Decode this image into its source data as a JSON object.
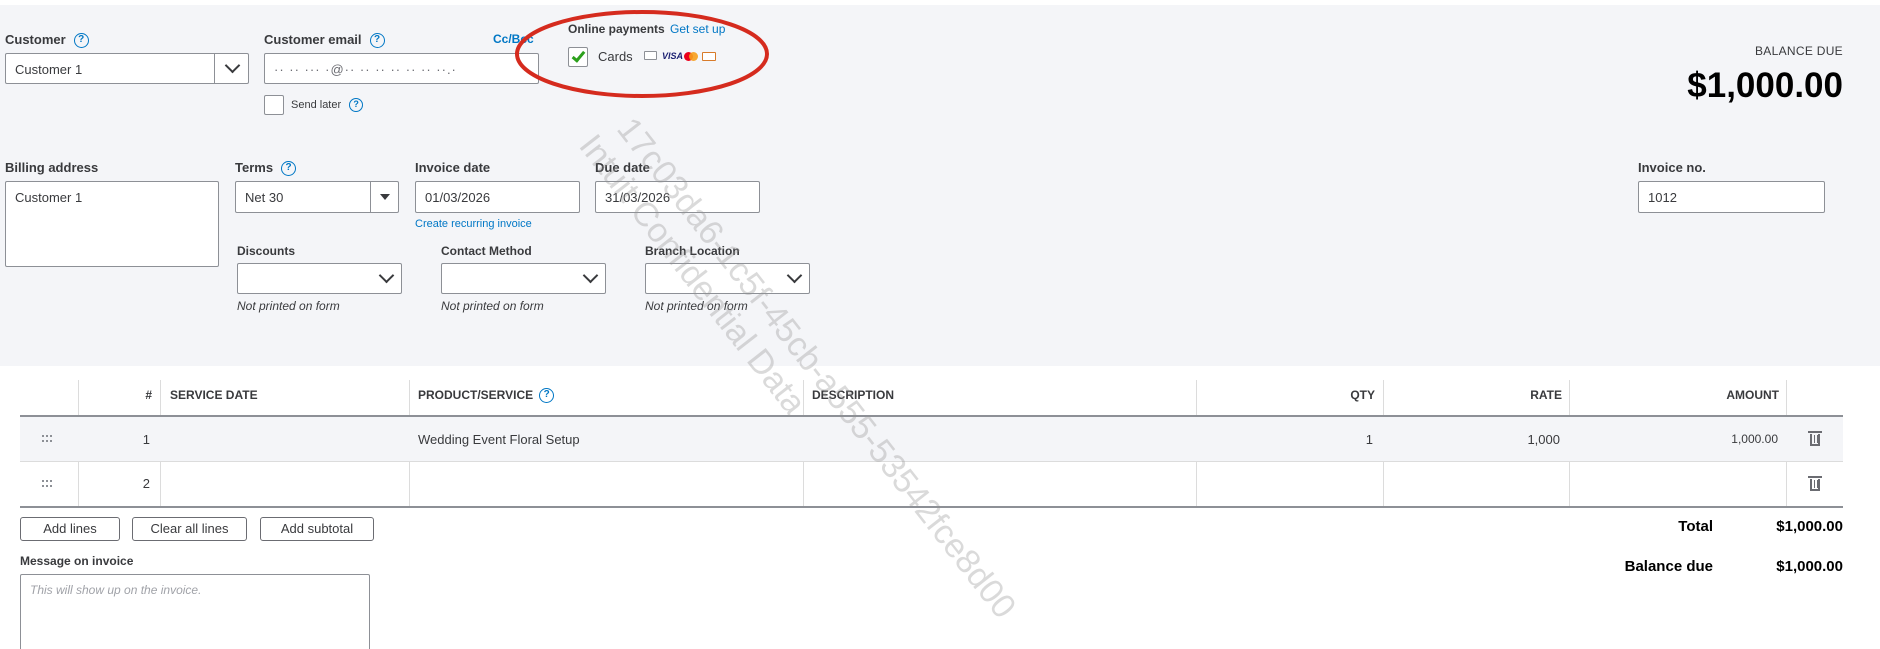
{
  "customer": {
    "label": "Customer",
    "value": "Customer 1"
  },
  "customer_email": {
    "label": "Customer email",
    "value": "·· ·· ··· ·@·· ·· ·· ·· ·· ·· ··.·",
    "cc_bcc": "Cc/Bcc",
    "send_later": "Send later"
  },
  "online_payments": {
    "label": "Online payments",
    "get_set_up": "Get set up",
    "cards_label": "Cards",
    "cards_checked": true,
    "card_icons": [
      "bank-icon",
      "visa-icon",
      "mastercard-icon",
      "amex-icon"
    ],
    "highlight_color": "#d52b1e"
  },
  "balance": {
    "label": "BALANCE DUE",
    "amount": "$1,000.00"
  },
  "billing_address": {
    "label": "Billing address",
    "value": "Customer 1"
  },
  "terms": {
    "label": "Terms",
    "value": "Net 30"
  },
  "invoice_date": {
    "label": "Invoice date",
    "value": "01/03/2026",
    "recurring_link": "Create recurring invoice"
  },
  "due_date": {
    "label": "Due date",
    "value": "31/03/2026"
  },
  "invoice_no": {
    "label": "Invoice no.",
    "value": "1012"
  },
  "custom_fields": [
    {
      "label": "Discounts",
      "note": "Not printed on form"
    },
    {
      "label": "Contact Method",
      "note": "Not printed on form"
    },
    {
      "label": "Branch Location",
      "note": "Not printed on form"
    }
  ],
  "table": {
    "headers": {
      "num": "#",
      "service_date": "SERVICE DATE",
      "product": "PRODUCT/SERVICE",
      "description": "DESCRIPTION",
      "qty": "QTY",
      "rate": "RATE",
      "amount": "AMOUNT"
    },
    "rows": [
      {
        "num": "1",
        "service_date": "",
        "product": "Wedding Event Floral Setup",
        "description": "",
        "qty": "1",
        "rate": "1,000",
        "amount": "1,000.00"
      },
      {
        "num": "2",
        "service_date": "",
        "product": "",
        "description": "",
        "qty": "",
        "rate": "",
        "amount": ""
      }
    ]
  },
  "buttons": {
    "add_lines": "Add lines",
    "clear_all_lines": "Clear all lines",
    "add_subtotal": "Add subtotal"
  },
  "totals": {
    "total_label": "Total",
    "total_value": "$1,000.00",
    "balance_due_label": "Balance due",
    "balance_due_value": "$1,000.00"
  },
  "message": {
    "label": "Message on invoice",
    "placeholder": "This will show up on the invoice."
  },
  "watermark": {
    "line1": "17c03da6-1c5f-45cb-a555-53542fce8d00",
    "line2": "Intuit Confidential Data"
  },
  "colors": {
    "accent": "#0077c5",
    "checkbox_green": "#2ca01c",
    "panel_bg": "#f4f5f8"
  }
}
